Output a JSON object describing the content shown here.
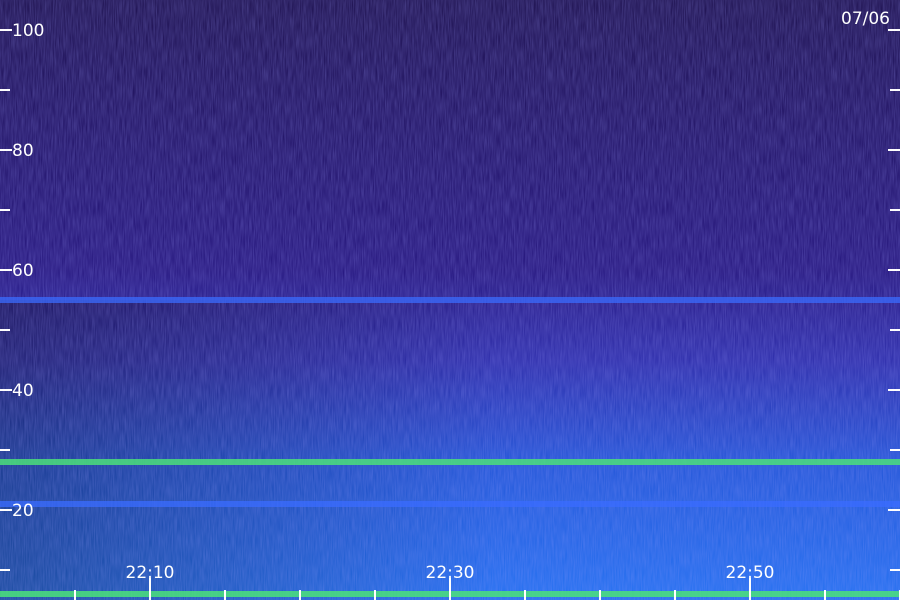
{
  "chart_data": {
    "type": "heatmap",
    "date_label": "07/06",
    "title": "",
    "xlabel": "",
    "ylabel": "",
    "y_ticks_labeled": [
      "100",
      "80",
      "60",
      "40",
      "20"
    ],
    "y_tick_values": [
      100,
      80,
      60,
      40,
      20
    ],
    "y_minor_tick_values": [
      90,
      70,
      50,
      30,
      10
    ],
    "ylim": [
      0,
      105
    ],
    "x_ticks_labeled": [
      "22:10",
      "22:30",
      "22:50"
    ],
    "x_tick_values": [
      "22:10",
      "22:30",
      "22:50"
    ],
    "xlim": [
      "22:05",
      "23:05"
    ],
    "x_minor_tick_interval_minutes": 5,
    "colorscale": [
      "#1a0d4a",
      "#2a1aa0",
      "#1f3fe0",
      "#1f8fff",
      "#33e07a",
      "#c8ff33"
    ],
    "features": [
      {
        "name": "band",
        "y": 55,
        "intensity": 0.55
      },
      {
        "name": "band",
        "y": 28,
        "intensity": 0.85
      },
      {
        "name": "band",
        "y": 21,
        "intensity": 0.6
      },
      {
        "name": "band",
        "y": 6,
        "intensity": 0.9
      }
    ],
    "grid": false
  }
}
